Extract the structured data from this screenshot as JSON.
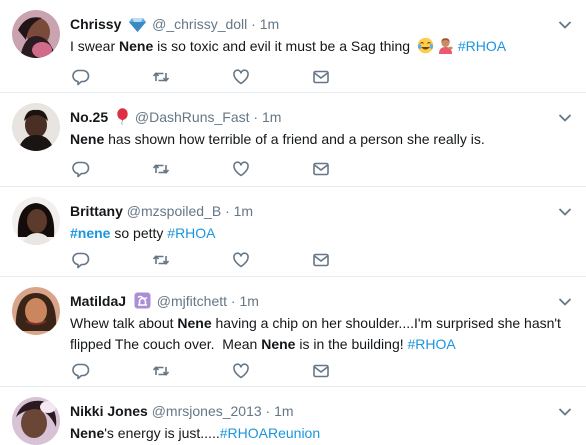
{
  "tweets": [
    {
      "name": "Chrissy",
      "badge_icon": "diamond-icon",
      "handle": "@_chrissy_doll",
      "dot": "·",
      "time": "1m",
      "segments": [
        {
          "t": "I swear "
        },
        {
          "t": "Nene",
          "b": true
        },
        {
          "t": " is so toxic and evil it must be a Sag thing "
        }
      ],
      "emojis": [
        "tears-of-joy-emoji",
        "person-tipping-hand-emoji"
      ],
      "tags": [
        "#RHOA"
      ]
    },
    {
      "name": "No.25",
      "badge_icon": "balloon-icon",
      "handle": "@DashRuns_Fast",
      "dot": "·",
      "time": "1m",
      "segments": [
        {
          "t": "Nene",
          "b": true
        },
        {
          "t": " has shown how terrible of a friend and a person she really is."
        }
      ]
    },
    {
      "name": "Brittany",
      "handle": "@mzspoiled_B",
      "dot": "·",
      "time": "1m",
      "segments": [
        {
          "t": "#nene",
          "tag": true,
          "b": true
        },
        {
          "t": " so petty "
        },
        {
          "t": "#RHOA",
          "tag": true
        }
      ]
    },
    {
      "name": "MatildaJ",
      "badge_icon": "ophiuchus-icon",
      "handle": "@mjfitchett",
      "dot": "·",
      "time": "1m",
      "segments": [
        {
          "t": "Whew talk about "
        },
        {
          "t": "Nene",
          "b": true
        },
        {
          "t": " having a chip on her shoulder....I'm surprised she hasn't flipped The couch over.  Mean "
        },
        {
          "t": "Nene",
          "b": true
        },
        {
          "t": " is in the building! "
        },
        {
          "t": "#RHOA",
          "tag": true
        }
      ]
    },
    {
      "name": "Nikki Jones",
      "handle": "@mrsjones_2013",
      "dot": "·",
      "time": "1m",
      "segments": [
        {
          "t": "Nene",
          "b": true
        },
        {
          "t": "'s energy is just....."
        },
        {
          "t": "#RHOAReunion",
          "tag": true
        }
      ]
    }
  ],
  "colors": {
    "text": "#14171a",
    "muted": "#657786",
    "link": "#1b95e0",
    "divider": "#e6ecf0"
  }
}
